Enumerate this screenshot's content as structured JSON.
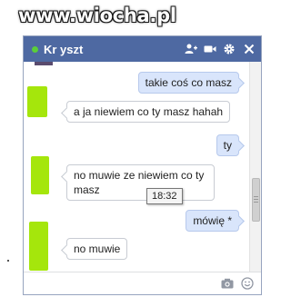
{
  "watermark": "www.wiocha.pl",
  "chat": {
    "title": "Kr yszt",
    "header_icons": [
      "add-friend-icon",
      "video-call-icon",
      "gear-icon",
      "close-icon"
    ],
    "footer_icons": [
      "camera-icon",
      "emoji-icon"
    ]
  },
  "messages": [
    {
      "direction": "out",
      "text": "takie coś co masz"
    },
    {
      "direction": "in",
      "text": "a ja niewiem co ty masz hahah"
    },
    {
      "direction": "out",
      "text": "ty"
    },
    {
      "direction": "in",
      "text": "no muwie ze niewiem co ty masz"
    },
    {
      "direction": "out",
      "text": "mówię *"
    },
    {
      "direction": "in",
      "text": "no muwie"
    }
  ],
  "tooltip": "18:32",
  "colors": {
    "titlebar": "#4e69a2",
    "online": "#5bce3a",
    "outgoing_bubble": "#d9e5fb",
    "avatar_placeholder": "#a5e60c"
  }
}
